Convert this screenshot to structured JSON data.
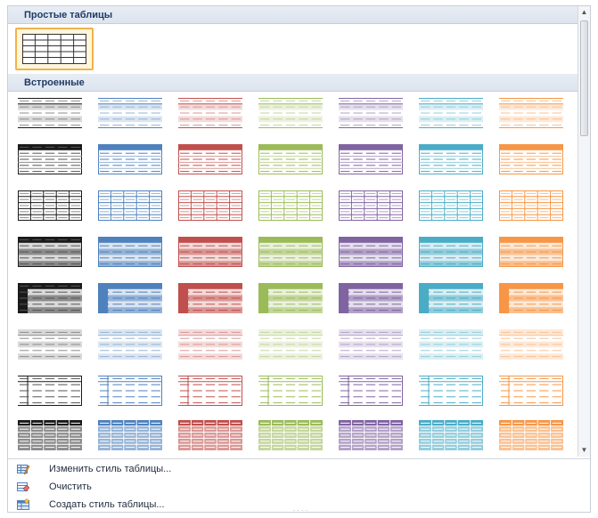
{
  "gallery": {
    "plain_section_title": "Простые таблицы",
    "builtin_section_title": "Встроенные",
    "palette": {
      "black": {
        "dark": "#1a1a1a",
        "mid": "#8c8c8c",
        "light": "#d9d9d9"
      },
      "blue": {
        "dark": "#4f81bd",
        "mid": "#95b3d7",
        "light": "#dbe5f1"
      },
      "red": {
        "dark": "#c0504d",
        "mid": "#da9694",
        "light": "#f2dcdb"
      },
      "green": {
        "dark": "#9bbb59",
        "mid": "#c3d69b",
        "light": "#ebf1de"
      },
      "purple": {
        "dark": "#8064a2",
        "mid": "#b2a1c7",
        "light": "#e5e0ec"
      },
      "aqua": {
        "dark": "#4bacc6",
        "mid": "#92cddc",
        "light": "#daeef3"
      },
      "orange": {
        "dark": "#f79646",
        "mid": "#fac090",
        "light": "#fde9d9"
      }
    },
    "columns": [
      "black",
      "blue",
      "red",
      "green",
      "purple",
      "aqua",
      "orange"
    ],
    "style_rows": [
      "light-shading",
      "light-list",
      "light-grid",
      "medium-shading",
      "medium-header-column",
      "light-striped",
      "left-column",
      "dark-fill"
    ]
  },
  "menu": {
    "items": [
      {
        "label": "Изменить стиль таблицы...",
        "icon": "modify-style-icon"
      },
      {
        "label": "Очистить",
        "icon": "clear-style-icon"
      },
      {
        "label": "Создать стиль таблицы...",
        "icon": "new-style-icon"
      }
    ]
  }
}
